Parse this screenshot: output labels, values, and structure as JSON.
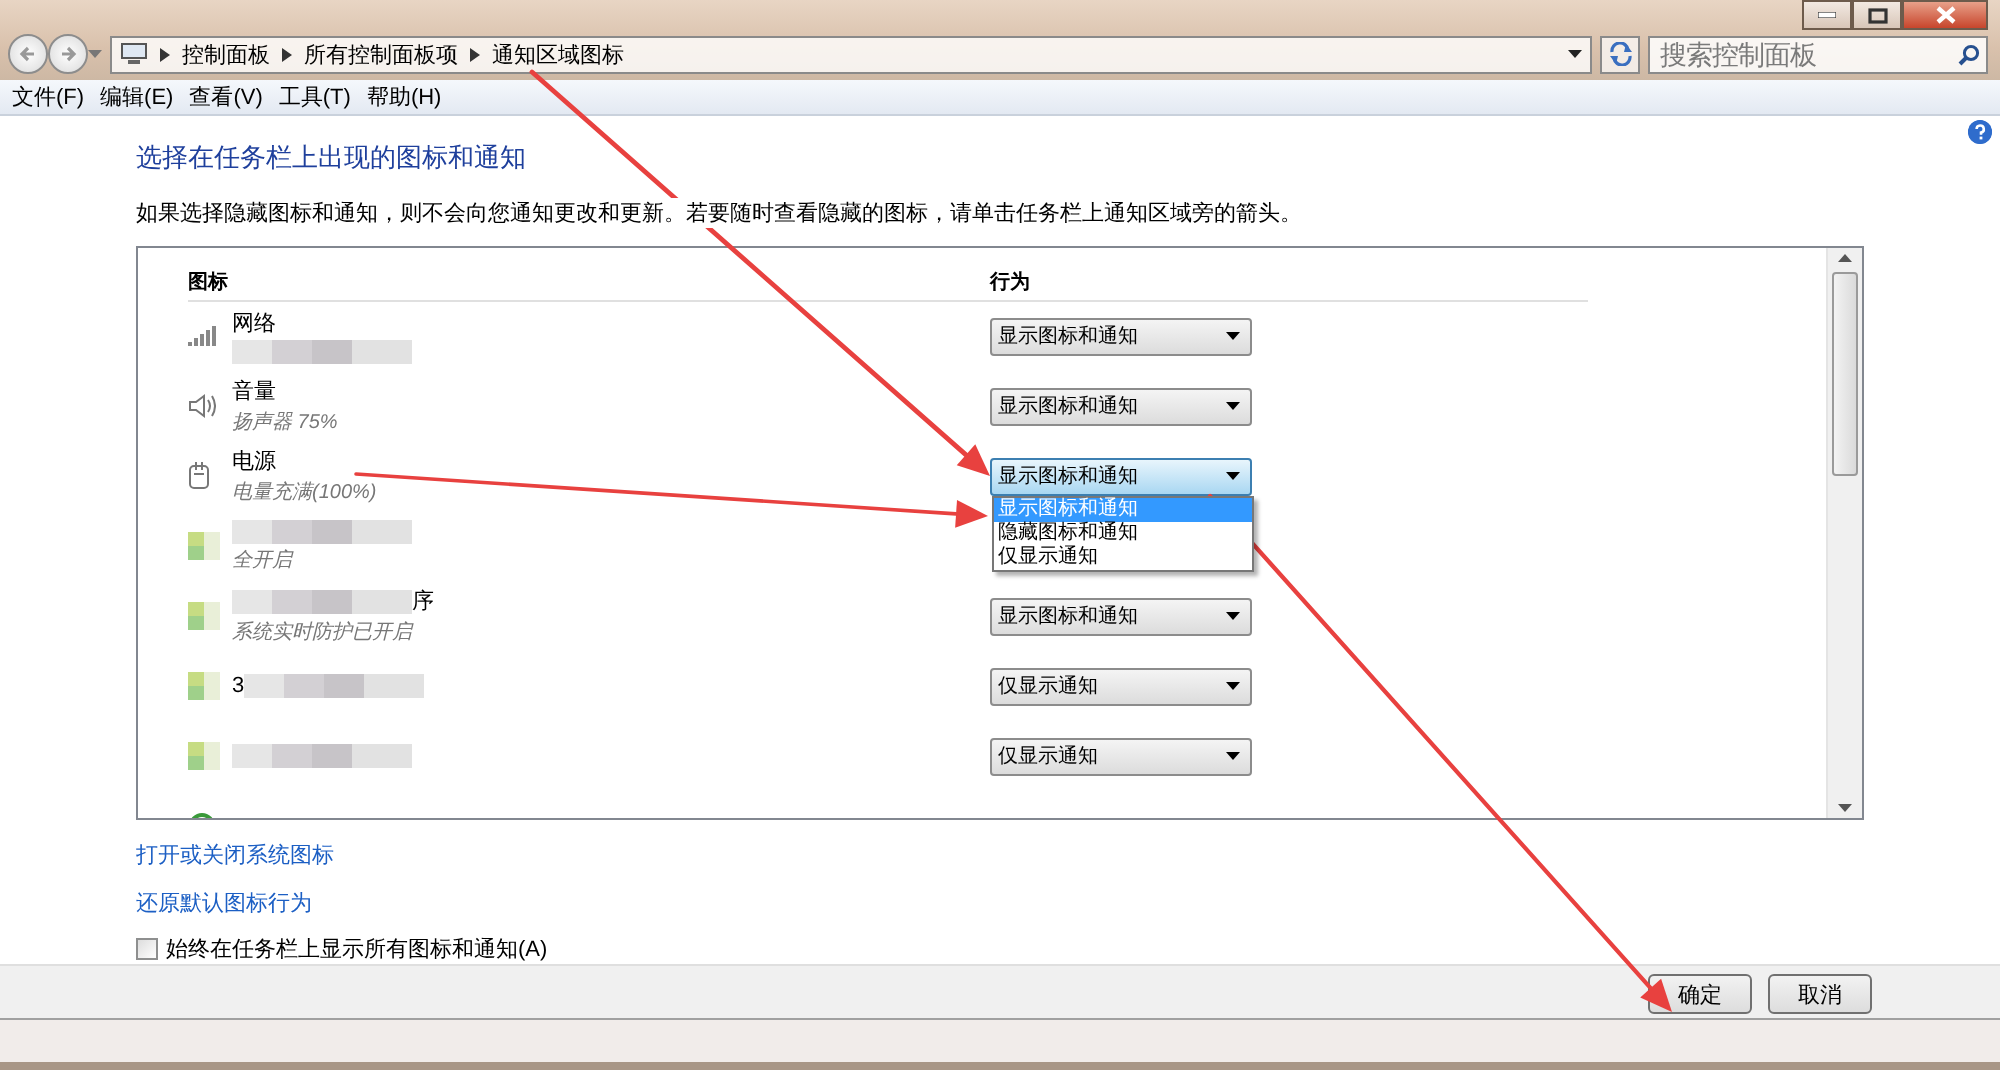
{
  "window": {
    "breadcrumb": [
      "控制面板",
      "所有控制面板项",
      "通知区域图标"
    ],
    "search": {
      "placeholder": "搜索控制面板"
    }
  },
  "menu": [
    "文件(F)",
    "编辑(E)",
    "查看(V)",
    "工具(T)",
    "帮助(H)"
  ],
  "heading": "选择在任务栏上出现的图标和通知",
  "description": "如果选择隐藏图标和通知，则不会向您通知更改和更新。若要随时查看隐藏的图标，请单击任务栏上通知区域旁的箭头。",
  "table": {
    "columns": [
      "图标",
      "行为"
    ],
    "rows": [
      {
        "kind": "network",
        "name": "网络",
        "behavior": "显示图标和通知",
        "expanded": false,
        "blurred": true
      },
      {
        "kind": "speaker",
        "name": "音量",
        "detail": "扬声器 75%",
        "behavior": "显示图标和通知",
        "expanded": false
      },
      {
        "kind": "power",
        "name": "电源",
        "detail": "电量充满(100%)",
        "behavior": "显示图标和通知",
        "expanded": true,
        "options": [
          {
            "label": "显示图标和通知",
            "selected": true
          },
          {
            "label": "隐藏图标和通知",
            "selected": false
          },
          {
            "label": "仅显示通知",
            "selected": false
          }
        ]
      },
      {
        "kind": "app",
        "detail": "全开启",
        "blurred": true
      },
      {
        "kind": "app",
        "name": "序",
        "detail": "系统实时防护已开启",
        "behavior": "显示图标和通知",
        "expanded": false,
        "blurred": true
      },
      {
        "kind": "app",
        "name": "3",
        "behavior": "仅显示通知",
        "expanded": false,
        "blurred": true
      },
      {
        "kind": "app",
        "behavior": "仅显示通知",
        "expanded": false,
        "blurred": true
      },
      {
        "kind": "ring"
      }
    ]
  },
  "links": [
    "打开或关闭系统图标",
    "还原默认图标行为"
  ],
  "checkbox": {
    "label": "始终在任务栏上显示所有图标和通知(A)",
    "checked": false
  },
  "buttons": [
    "确定",
    "取消"
  ],
  "annotations": [
    {
      "kind": "arrow"
    },
    {
      "kind": "arrow"
    },
    {
      "kind": "arrow"
    }
  ]
}
